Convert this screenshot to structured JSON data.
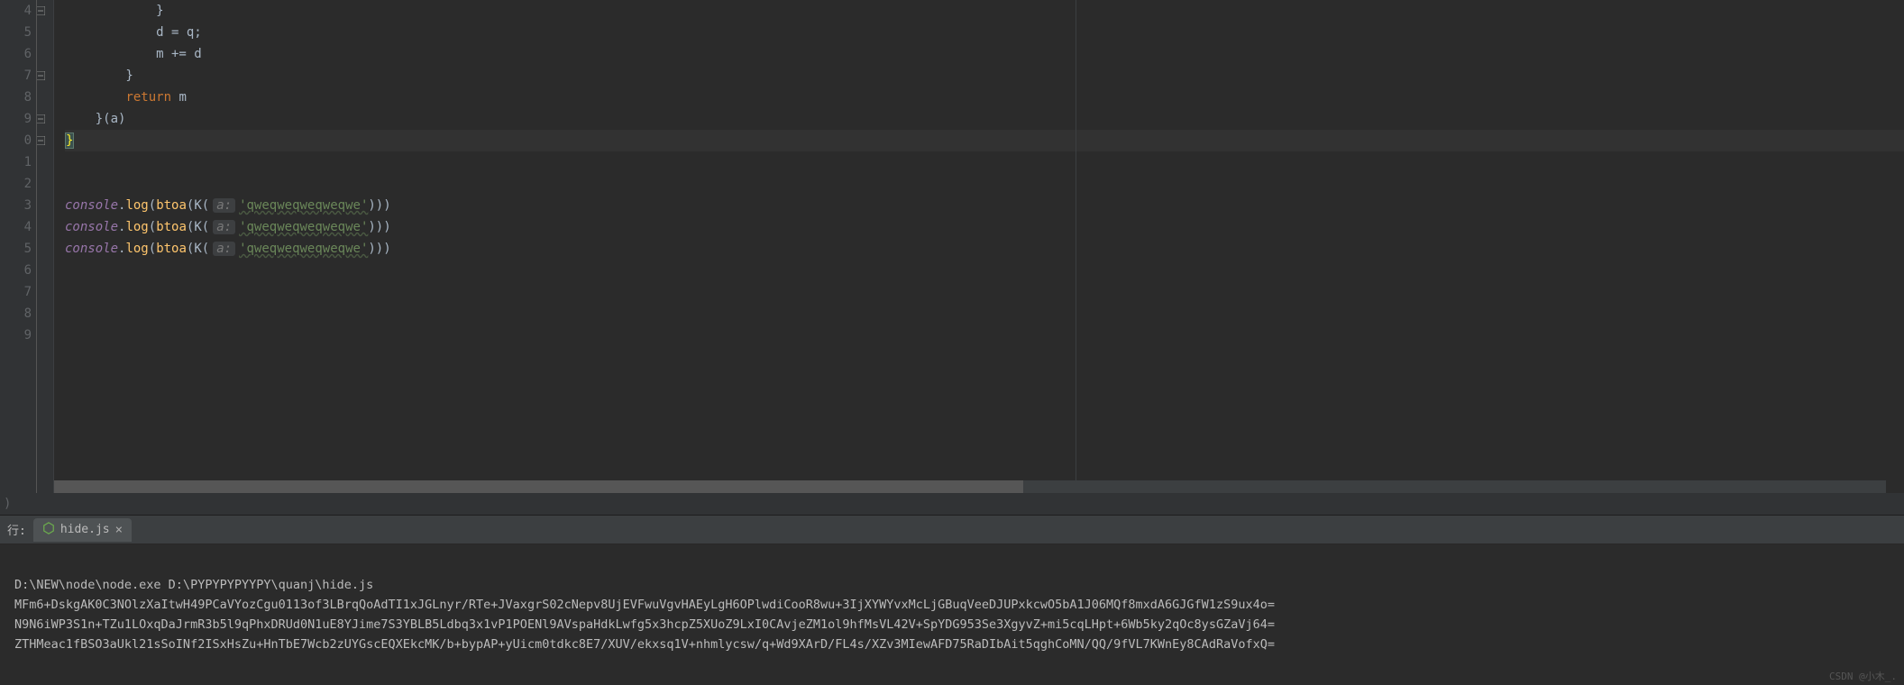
{
  "editor": {
    "lineNumbers": [
      "4",
      "5",
      "6",
      "7",
      "8",
      "9",
      "0",
      "1",
      "2",
      "3",
      "4",
      "5",
      "6",
      "7",
      "8",
      "9"
    ],
    "fold": [
      true,
      false,
      false,
      true,
      false,
      true,
      true,
      false,
      false,
      false,
      false,
      false,
      false,
      false,
      false,
      false
    ],
    "lines": {
      "l4": "            }",
      "l5": "            d = q;",
      "l6": "            m += d",
      "l7": "        }",
      "l8_kw": "return",
      "l8_rest": " m",
      "l9": "    }(a)",
      "l10": "}",
      "l13_hint": "a:",
      "l13_str": "'qweqweqweqweqwe'",
      "l14_hint": "a:",
      "l14_str": "'qweqweqweqweqwe'",
      "l15_hint": "a:",
      "l15_str": "'qweqweqweqweqwe'"
    },
    "console": "console",
    "log": "log",
    "btoa": "btoa",
    "K": "K"
  },
  "runPanel": {
    "label": "行:",
    "tabName": "hide.js",
    "closeGlyph": "×"
  },
  "output": {
    "cmd": "D:\\NEW\\node\\node.exe D:\\PYPYPYPYYPY\\quanj\\hide.js",
    "line1": "MFm6+DskgAK0C3NOlzXaItwH49PCaVYozCgu0113of3LBrqQoAdTI1xJGLnyr/RTe+JVaxgrS02cNepv8UjEVFwuVgvHAEyLgH6OPlwdiCooR8wu+3IjXYWYvxMcLjGBuqVeeDJUPxkcwO5bA1J06MQf8mxdA6GJGfW1zS9ux4o=",
    "line2": "N9N6iWP3S1n+TZu1LOxqDaJrmR3b5l9qPhxDRUd0N1uE8YJime7S3YBLB5Ldbq3x1vP1POENl9AVspaHdkLwfg5x3hcpZ5XUoZ9LxI0CAvjeZM1ol9hfMsVL42V+SpYDG953Se3XgyvZ+mi5cqLHpt+6Wb5ky2qOc8ysGZaVj64=",
    "line3": "ZTHMeac1fBSO3aUkl21sSoINf2ISxHsZu+HnTbE7Wcb2zUYGscEQXEkcMK/b+bypAP+yUicm0tdkc8E7/XUV/ekxsq1V+nhmlycsw/q+Wd9XArD/FL4s/XZv3MIewAFD75RaDIbAit5qghCoMN/QQ/9fVL7KWnEy8CAdRaVofxQ="
  },
  "watermark": "CSDN @小木_."
}
